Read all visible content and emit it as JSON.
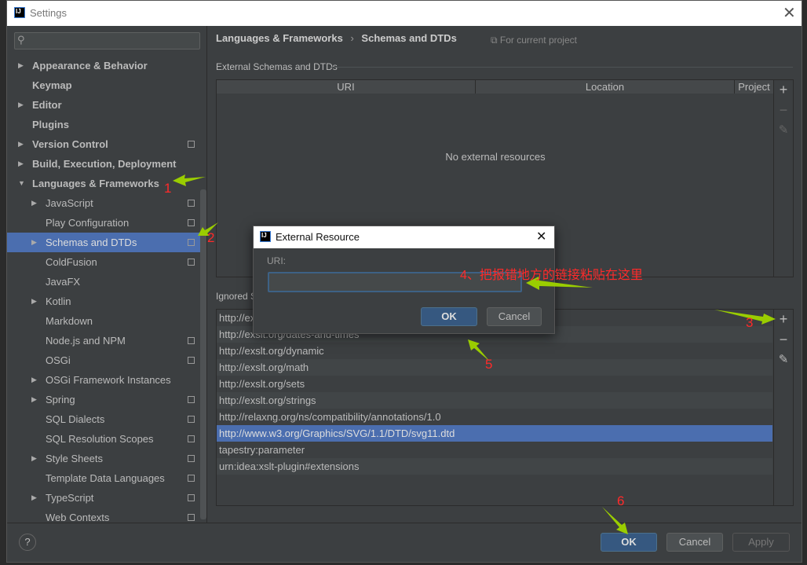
{
  "window": {
    "title": "Settings",
    "close_icon": "close-icon"
  },
  "sidebar": {
    "search_placeholder": "",
    "items": [
      {
        "label": "Appearance & Behavior",
        "level": 0,
        "expandable": true,
        "project": false
      },
      {
        "label": "Keymap",
        "level": 0,
        "expandable": false,
        "project": false
      },
      {
        "label": "Editor",
        "level": 0,
        "expandable": true,
        "project": false
      },
      {
        "label": "Plugins",
        "level": 0,
        "expandable": false,
        "project": false
      },
      {
        "label": "Version Control",
        "level": 0,
        "expandable": true,
        "project": true
      },
      {
        "label": "Build, Execution, Deployment",
        "level": 0,
        "expandable": true,
        "project": false
      },
      {
        "label": "Languages & Frameworks",
        "level": 0,
        "expandable": true,
        "expanded": true,
        "project": false
      },
      {
        "label": "JavaScript",
        "level": 1,
        "expandable": true,
        "project": true
      },
      {
        "label": "Play Configuration",
        "level": 1,
        "expandable": false,
        "project": true
      },
      {
        "label": "Schemas and DTDs",
        "level": 1,
        "expandable": true,
        "project": true,
        "selected": true
      },
      {
        "label": "ColdFusion",
        "level": 1,
        "expandable": false,
        "project": true
      },
      {
        "label": "JavaFX",
        "level": 1,
        "expandable": false,
        "project": false
      },
      {
        "label": "Kotlin",
        "level": 1,
        "expandable": true,
        "project": false
      },
      {
        "label": "Markdown",
        "level": 1,
        "expandable": false,
        "project": false
      },
      {
        "label": "Node.js and NPM",
        "level": 1,
        "expandable": false,
        "project": true
      },
      {
        "label": "OSGi",
        "level": 1,
        "expandable": false,
        "project": true
      },
      {
        "label": "OSGi Framework Instances",
        "level": 1,
        "expandable": true,
        "project": false
      },
      {
        "label": "Spring",
        "level": 1,
        "expandable": true,
        "project": true
      },
      {
        "label": "SQL Dialects",
        "level": 1,
        "expandable": false,
        "project": true
      },
      {
        "label": "SQL Resolution Scopes",
        "level": 1,
        "expandable": false,
        "project": true
      },
      {
        "label": "Style Sheets",
        "level": 1,
        "expandable": true,
        "project": true
      },
      {
        "label": "Template Data Languages",
        "level": 1,
        "expandable": false,
        "project": true
      },
      {
        "label": "TypeScript",
        "level": 1,
        "expandable": true,
        "project": true
      },
      {
        "label": "Web Contexts",
        "level": 1,
        "expandable": false,
        "project": true
      }
    ]
  },
  "main": {
    "breadcrumb": [
      "Languages & Frameworks",
      "Schemas and DTDs"
    ],
    "breadcrumb_sep": "›",
    "scope": "For current project",
    "external": {
      "title": "External Schemas and DTDs",
      "columns": [
        "URI",
        "Location",
        "Project"
      ],
      "empty": "No external resources"
    },
    "ignored": {
      "title": "Ignored Schemas and DTDs",
      "rows": [
        "http://exslt.org/common",
        "http://exslt.org/dates-and-times",
        "http://exslt.org/dynamic",
        "http://exslt.org/math",
        "http://exslt.org/sets",
        "http://exslt.org/strings",
        "http://relaxng.org/ns/compatibility/annotations/1.0",
        "http://www.w3.org/Graphics/SVG/1.1/DTD/svg11.dtd",
        "tapestry:parameter",
        "urn:idea:xslt-plugin#extensions"
      ],
      "selected_index": 7
    },
    "tools": {
      "add": "+",
      "remove": "−",
      "edit": "✎"
    }
  },
  "footer": {
    "help": "?",
    "ok": "OK",
    "cancel": "Cancel",
    "apply": "Apply"
  },
  "dialog": {
    "title": "External Resource",
    "uri_label": "URI:",
    "uri_value": "",
    "ok": "OK",
    "cancel": "Cancel"
  },
  "annotations": {
    "n1": "1",
    "n2": "2",
    "n3": "3",
    "n4": "4、把报错地方的链接粘贴在这里",
    "n5": "5",
    "n6": "6",
    "arrow_color": "#9acd00",
    "text_color": "#ff2a2a"
  }
}
